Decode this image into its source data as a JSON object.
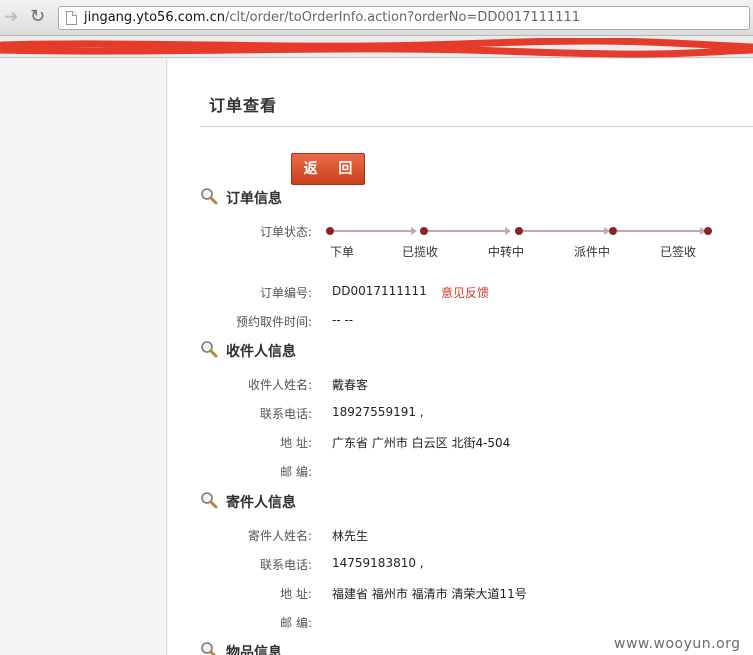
{
  "browser": {
    "url_host": "jingang.yto56.com.cn",
    "url_path": "/clt/order/toOrderInfo.action?orderNo=DD0017111111"
  },
  "page": {
    "title": "订单查看",
    "back_button": "返  回"
  },
  "order_info": {
    "heading": "订单信息",
    "status_label": "订单状态:",
    "status_steps": [
      "下单",
      "已揽收",
      "中转中",
      "派件中",
      "已签收"
    ],
    "order_no_label": "订单编号:",
    "order_no": "DD0017111111",
    "feedback_link": "意见反馈",
    "pickup_time_label": "预约取件时间:",
    "pickup_time": "-- --"
  },
  "receiver": {
    "heading": "收件人信息",
    "name_label": "收件人姓名:",
    "name": "戴春客",
    "phone_label": "联系电话:",
    "phone": "18927559191 ,",
    "address_label": "地 址:",
    "address": "广东省 广州市 白云区 北街4-504",
    "postcode_label": "邮 编:"
  },
  "sender": {
    "heading": "寄件人信息",
    "name_label": "寄件人姓名:",
    "name": "林先生",
    "phone_label": "联系电话:",
    "phone": "14759183810 ,",
    "address_label": "地 址:",
    "address": "福建省 福州市 福清市 清荣大道11号",
    "postcode_label": "邮 编:"
  },
  "goods": {
    "heading": "物品信息"
  },
  "watermark": "www.wooyun.org",
  "icons": [
    "back-arrow-icon",
    "reload-icon",
    "page-icon",
    "magnifier-icon"
  ],
  "colors": {
    "button": "#d44f2a",
    "feedback": "#d33a2c",
    "progress_dot": "#8a2424",
    "redaction": "#e63a2a"
  }
}
